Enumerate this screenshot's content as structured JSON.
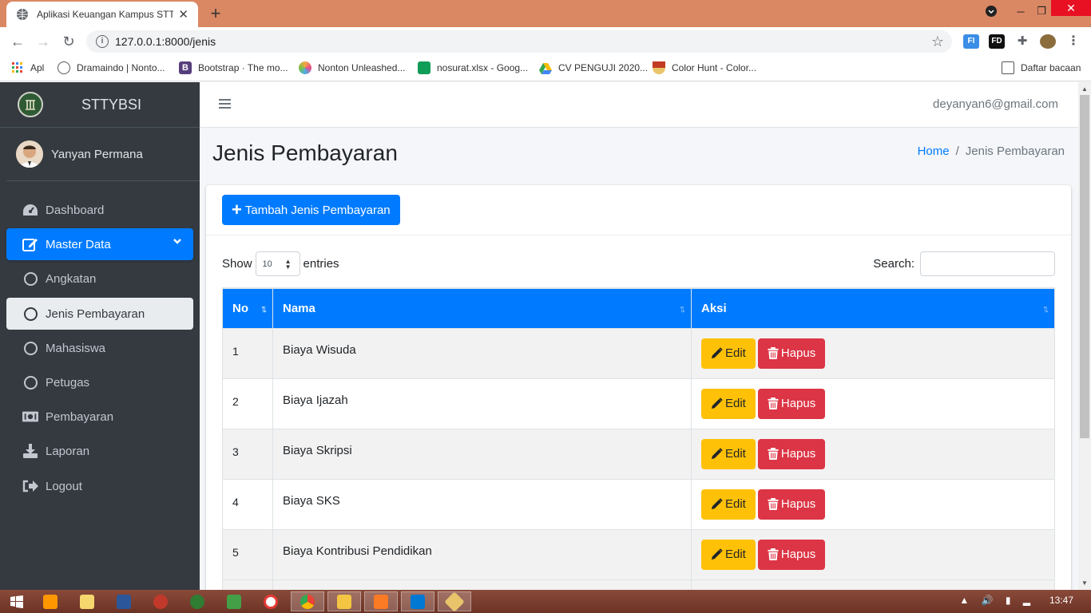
{
  "browser": {
    "tab_title": "Aplikasi Keuangan Kampus STTYBSI",
    "url": "127.0.0.1:8000/jenis",
    "bookmarks": [
      {
        "label": "Apl",
        "color": "#ea4335"
      },
      {
        "label": "Dramaindo | Nonto...",
        "color": "#555555"
      },
      {
        "label": "Bootstrap · The mo...",
        "color": "#563d7c"
      },
      {
        "label": "Nonton Unleashed...",
        "color": "#f4a742"
      },
      {
        "label": "nosurat.xlsx - Goog...",
        "color": "#0f9d58"
      },
      {
        "label": "CV PENGUJI 2020...",
        "color": "#1a73e8"
      },
      {
        "label": "Color Hunt - Color...",
        "color": "#b8860b"
      }
    ],
    "reading_list": "Daftar bacaan"
  },
  "sidebar": {
    "brand": "STTYBSI",
    "user_name": "Yanyan Permana",
    "items": [
      {
        "label": "Dashboard",
        "icon": "dashboard-icon"
      },
      {
        "label": "Master Data",
        "icon": "edit-icon"
      },
      {
        "label": "Angkatan",
        "icon": "circle-icon"
      },
      {
        "label": "Jenis Pembayaran",
        "icon": "circle-icon"
      },
      {
        "label": "Mahasiswa",
        "icon": "circle-icon"
      },
      {
        "label": "Petugas",
        "icon": "circle-icon"
      },
      {
        "label": "Pembayaran",
        "icon": "money-icon"
      },
      {
        "label": "Laporan",
        "icon": "download-icon"
      },
      {
        "label": "Logout",
        "icon": "logout-icon"
      }
    ]
  },
  "header": {
    "user_email": "deyanyan6@gmail.com"
  },
  "page": {
    "title": "Jenis Pembayaran",
    "breadcrumb": {
      "home": "Home",
      "current": "Jenis Pembayaran"
    }
  },
  "card": {
    "add_button": "Tambah Jenis Pembayaran",
    "show_label": "Show",
    "entries_value": "10",
    "entries_label": "entries",
    "search_label": "Search:"
  },
  "table": {
    "headers": [
      "No",
      "Nama",
      "Aksi"
    ],
    "rows": [
      {
        "no": "1",
        "nama": "Biaya Wisuda"
      },
      {
        "no": "2",
        "nama": "Biaya Ijazah"
      },
      {
        "no": "3",
        "nama": "Biaya Skripsi"
      },
      {
        "no": "4",
        "nama": "Biaya SKS"
      },
      {
        "no": "5",
        "nama": "Biaya Kontribusi Pendidikan"
      }
    ],
    "edit_label": "Edit",
    "delete_label": "Hapus"
  },
  "taskbar": {
    "clock": "13:47"
  },
  "colors": {
    "primary": "#007bff",
    "warning": "#ffc107",
    "danger": "#dc3545",
    "sidebar": "#343a40",
    "titlebar": "#da8763"
  }
}
